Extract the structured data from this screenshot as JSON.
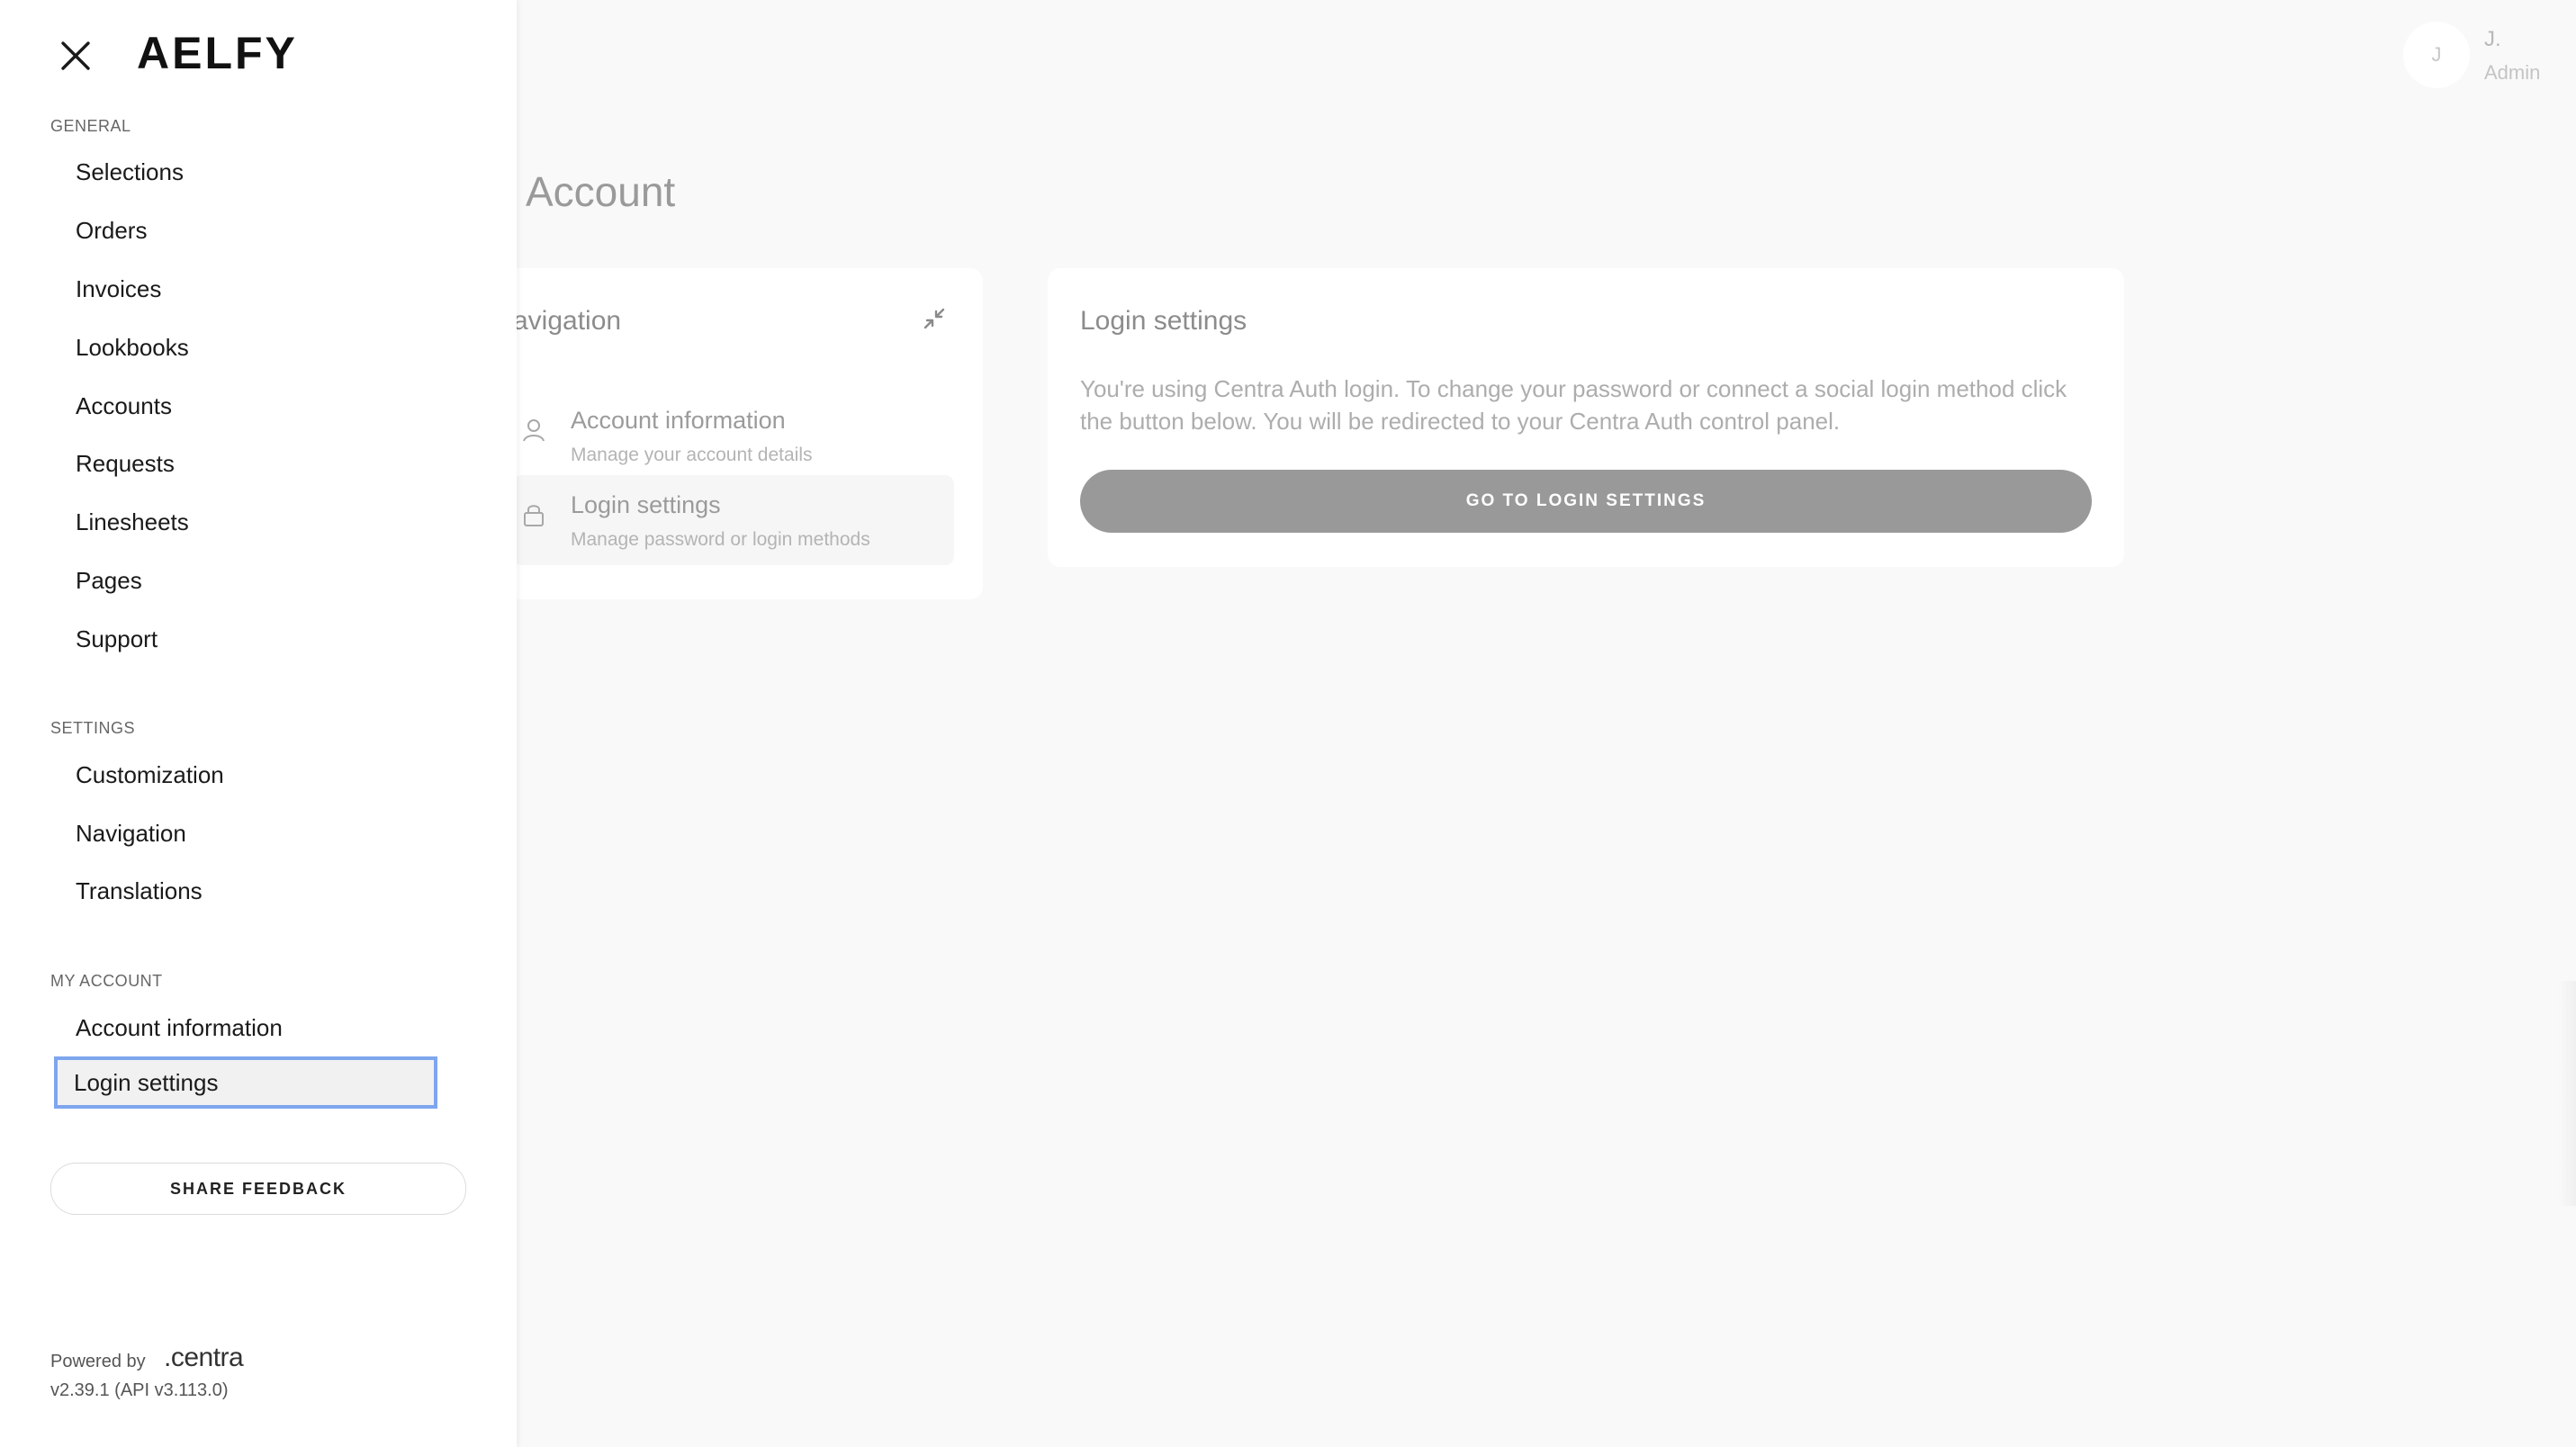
{
  "header": {
    "avatar_initial": "J",
    "user_name": "J.",
    "user_role": "Admin"
  },
  "page": {
    "title": "Account"
  },
  "nav_card": {
    "title": "avigation",
    "items": [
      {
        "title": "Account information",
        "subtitle": "Manage your account details",
        "icon": "user-icon"
      },
      {
        "title": "Login settings",
        "subtitle": "Manage password or login methods",
        "icon": "lock-icon"
      }
    ]
  },
  "login_card": {
    "title": "Login settings",
    "description": "You're using Centra Auth login. To change your password or connect a social login method click the button below. You will be redirected to your Centra Auth control panel.",
    "button_label": "GO TO LOGIN SETTINGS"
  },
  "drawer": {
    "brand": "AELFY",
    "sections": [
      {
        "label": "GENERAL",
        "items": [
          "Selections",
          "Orders",
          "Invoices",
          "Lookbooks",
          "Accounts",
          "Requests",
          "Linesheets",
          "Pages",
          "Support"
        ]
      },
      {
        "label": "SETTINGS",
        "items": [
          "Customization",
          "Navigation",
          "Translations"
        ]
      },
      {
        "label": "MY ACCOUNT",
        "items": [
          "Account information",
          "Login settings"
        ]
      }
    ],
    "feedback_label": "SHARE FEEDBACK",
    "powered_by": "Powered by",
    "powered_logo": ".centra",
    "version": "v2.39.1 (API v3.113.0)"
  },
  "colors": {
    "focus_outline": "#7ea6ee",
    "button_gray": "#999999",
    "page_bg": "#f9f9f9"
  }
}
